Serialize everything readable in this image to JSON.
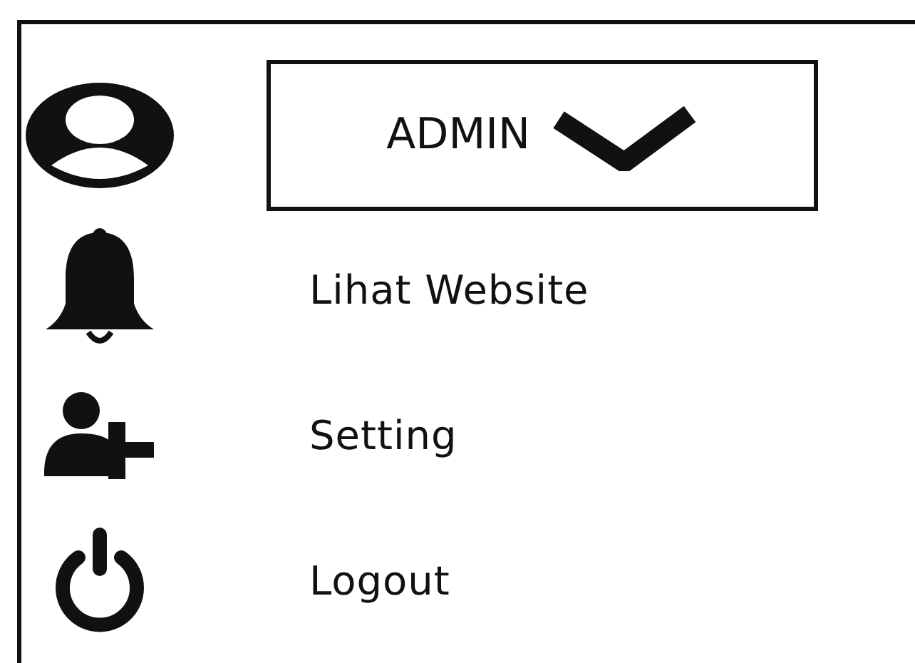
{
  "user_menu": {
    "button": {
      "label": "ADMIN"
    },
    "items": [
      {
        "label": "Lihat Website"
      },
      {
        "label": "Setting"
      },
      {
        "label": "Logout"
      }
    ]
  }
}
